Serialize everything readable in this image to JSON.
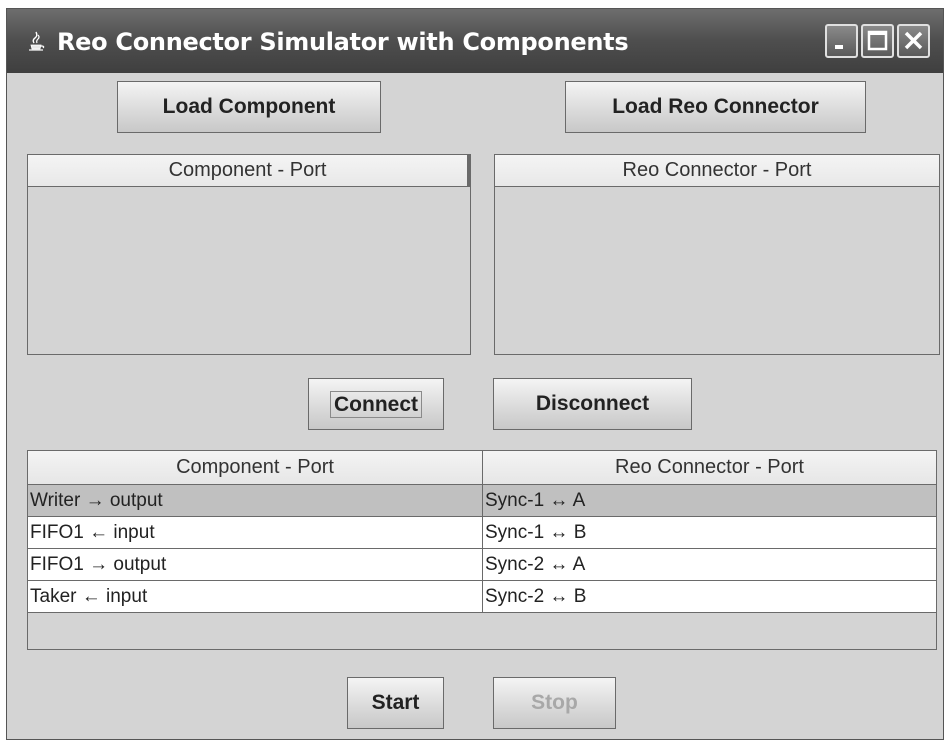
{
  "window": {
    "title": "Reo Connector Simulator with Components"
  },
  "toolbar": {
    "load_component": "Load Component",
    "load_reo_connector": "Load Reo Connector"
  },
  "left_panel": {
    "header": "Component - Port"
  },
  "right_panel": {
    "header": "Reo Connector - Port"
  },
  "actions": {
    "connect": "Connect",
    "disconnect": "Disconnect"
  },
  "connections_table": {
    "columns": [
      "Component - Port",
      "Reo Connector - Port"
    ],
    "rows": [
      {
        "component_port": "Writer → output",
        "connector_port": "Sync-1 ↔ A",
        "selected": true
      },
      {
        "component_port": "FIFO1 ← input",
        "connector_port": "Sync-1 ↔ B",
        "selected": false
      },
      {
        "component_port": "FIFO1 → output",
        "connector_port": "Sync-2 ↔ A",
        "selected": false
      },
      {
        "component_port": "Taker ← input",
        "connector_port": "Sync-2 ↔ B",
        "selected": false
      }
    ]
  },
  "simulation": {
    "start": "Start",
    "stop": "Stop",
    "stop_enabled": false
  },
  "icons": [
    "java-app-icon",
    "minimize-icon",
    "maximize-icon",
    "close-icon"
  ]
}
